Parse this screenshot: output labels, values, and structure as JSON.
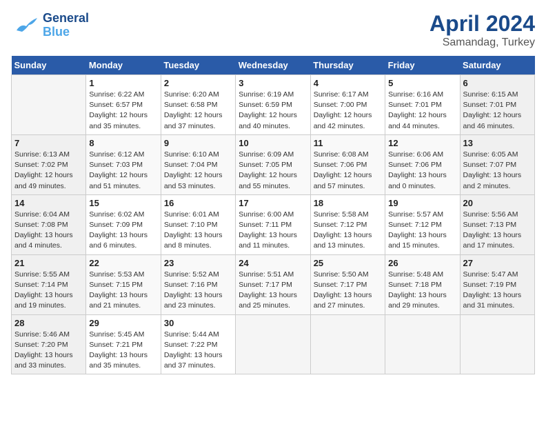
{
  "header": {
    "logo_line1": "General",
    "logo_line2": "Blue",
    "month": "April 2024",
    "location": "Samandag, Turkey"
  },
  "weekdays": [
    "Sunday",
    "Monday",
    "Tuesday",
    "Wednesday",
    "Thursday",
    "Friday",
    "Saturday"
  ],
  "rows": [
    [
      {
        "day": "",
        "info": ""
      },
      {
        "day": "1",
        "info": "Sunrise: 6:22 AM\nSunset: 6:57 PM\nDaylight: 12 hours\nand 35 minutes."
      },
      {
        "day": "2",
        "info": "Sunrise: 6:20 AM\nSunset: 6:58 PM\nDaylight: 12 hours\nand 37 minutes."
      },
      {
        "day": "3",
        "info": "Sunrise: 6:19 AM\nSunset: 6:59 PM\nDaylight: 12 hours\nand 40 minutes."
      },
      {
        "day": "4",
        "info": "Sunrise: 6:17 AM\nSunset: 7:00 PM\nDaylight: 12 hours\nand 42 minutes."
      },
      {
        "day": "5",
        "info": "Sunrise: 6:16 AM\nSunset: 7:01 PM\nDaylight: 12 hours\nand 44 minutes."
      },
      {
        "day": "6",
        "info": "Sunrise: 6:15 AM\nSunset: 7:01 PM\nDaylight: 12 hours\nand 46 minutes."
      }
    ],
    [
      {
        "day": "7",
        "info": "Sunrise: 6:13 AM\nSunset: 7:02 PM\nDaylight: 12 hours\nand 49 minutes."
      },
      {
        "day": "8",
        "info": "Sunrise: 6:12 AM\nSunset: 7:03 PM\nDaylight: 12 hours\nand 51 minutes."
      },
      {
        "day": "9",
        "info": "Sunrise: 6:10 AM\nSunset: 7:04 PM\nDaylight: 12 hours\nand 53 minutes."
      },
      {
        "day": "10",
        "info": "Sunrise: 6:09 AM\nSunset: 7:05 PM\nDaylight: 12 hours\nand 55 minutes."
      },
      {
        "day": "11",
        "info": "Sunrise: 6:08 AM\nSunset: 7:06 PM\nDaylight: 12 hours\nand 57 minutes."
      },
      {
        "day": "12",
        "info": "Sunrise: 6:06 AM\nSunset: 7:06 PM\nDaylight: 13 hours\nand 0 minutes."
      },
      {
        "day": "13",
        "info": "Sunrise: 6:05 AM\nSunset: 7:07 PM\nDaylight: 13 hours\nand 2 minutes."
      }
    ],
    [
      {
        "day": "14",
        "info": "Sunrise: 6:04 AM\nSunset: 7:08 PM\nDaylight: 13 hours\nand 4 minutes."
      },
      {
        "day": "15",
        "info": "Sunrise: 6:02 AM\nSunset: 7:09 PM\nDaylight: 13 hours\nand 6 minutes."
      },
      {
        "day": "16",
        "info": "Sunrise: 6:01 AM\nSunset: 7:10 PM\nDaylight: 13 hours\nand 8 minutes."
      },
      {
        "day": "17",
        "info": "Sunrise: 6:00 AM\nSunset: 7:11 PM\nDaylight: 13 hours\nand 11 minutes."
      },
      {
        "day": "18",
        "info": "Sunrise: 5:58 AM\nSunset: 7:12 PM\nDaylight: 13 hours\nand 13 minutes."
      },
      {
        "day": "19",
        "info": "Sunrise: 5:57 AM\nSunset: 7:12 PM\nDaylight: 13 hours\nand 15 minutes."
      },
      {
        "day": "20",
        "info": "Sunrise: 5:56 AM\nSunset: 7:13 PM\nDaylight: 13 hours\nand 17 minutes."
      }
    ],
    [
      {
        "day": "21",
        "info": "Sunrise: 5:55 AM\nSunset: 7:14 PM\nDaylight: 13 hours\nand 19 minutes."
      },
      {
        "day": "22",
        "info": "Sunrise: 5:53 AM\nSunset: 7:15 PM\nDaylight: 13 hours\nand 21 minutes."
      },
      {
        "day": "23",
        "info": "Sunrise: 5:52 AM\nSunset: 7:16 PM\nDaylight: 13 hours\nand 23 minutes."
      },
      {
        "day": "24",
        "info": "Sunrise: 5:51 AM\nSunset: 7:17 PM\nDaylight: 13 hours\nand 25 minutes."
      },
      {
        "day": "25",
        "info": "Sunrise: 5:50 AM\nSunset: 7:17 PM\nDaylight: 13 hours\nand 27 minutes."
      },
      {
        "day": "26",
        "info": "Sunrise: 5:48 AM\nSunset: 7:18 PM\nDaylight: 13 hours\nand 29 minutes."
      },
      {
        "day": "27",
        "info": "Sunrise: 5:47 AM\nSunset: 7:19 PM\nDaylight: 13 hours\nand 31 minutes."
      }
    ],
    [
      {
        "day": "28",
        "info": "Sunrise: 5:46 AM\nSunset: 7:20 PM\nDaylight: 13 hours\nand 33 minutes."
      },
      {
        "day": "29",
        "info": "Sunrise: 5:45 AM\nSunset: 7:21 PM\nDaylight: 13 hours\nand 35 minutes."
      },
      {
        "day": "30",
        "info": "Sunrise: 5:44 AM\nSunset: 7:22 PM\nDaylight: 13 hours\nand 37 minutes."
      },
      {
        "day": "",
        "info": ""
      },
      {
        "day": "",
        "info": ""
      },
      {
        "day": "",
        "info": ""
      },
      {
        "day": "",
        "info": ""
      }
    ]
  ]
}
